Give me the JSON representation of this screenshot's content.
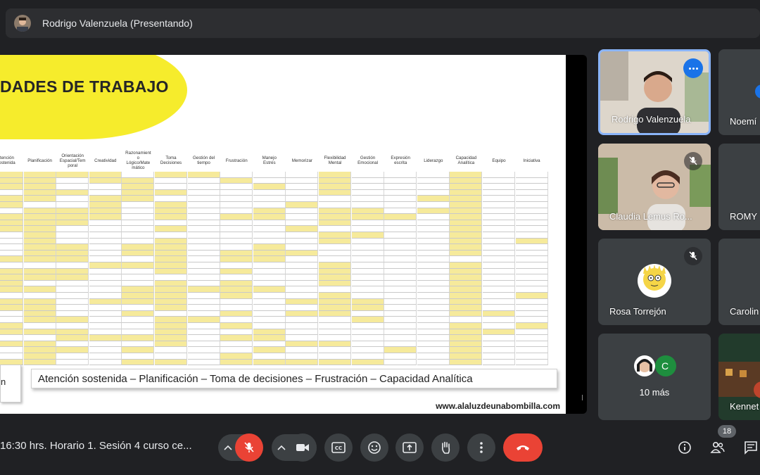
{
  "top_bar": {
    "presenter_label": "Rodrigo Valenzuela (Presentando)"
  },
  "slide": {
    "title": "DADES DE TRABAJO",
    "columns": [
      "tención\nostenida",
      "Planificación",
      "Orientación\nEspacial/Tem\nporal",
      "Creatividad",
      "Razonamient\no\nLógico/Mate\nmático",
      "Toma\nDecisiones",
      "Gestión del\ntiempo",
      "Frustración",
      "Manejo\nEstrés",
      "Memorizar",
      "Flexibilidad\nMental",
      "Gestión\nEmocional",
      "Expresión\nescrita",
      "Liderazgo",
      "Capacidad\nAnalítica",
      "Equipo",
      "Iniciativa"
    ],
    "left_box_text": "n",
    "summary": "Atención sostenida – Planificación – Toma de decisiones – Frustración – Capacidad Analítica",
    "website": "www.alaluzdeunabombilla.com"
  },
  "participants": [
    {
      "name": "Rodrigo Valenzuela",
      "active": true
    },
    {
      "name": "Noemí"
    },
    {
      "name": "Claudia Lemus Ro..."
    },
    {
      "name": "ROMY"
    },
    {
      "name": "Rosa Torrejón"
    },
    {
      "name": "Carolin"
    },
    {
      "name": "10 más",
      "avatar_letter": "C"
    },
    {
      "name": "Kennet"
    }
  ],
  "bottom_bar": {
    "meeting_info": "16:30 hrs. Horario 1. Sesión 4 curso ce...",
    "participant_count": "18"
  },
  "colors": {
    "accent": "#8ab4f8",
    "end_call": "#ea4335",
    "highlight": "#f6ea9b",
    "title_blob": "#f6ec2c"
  }
}
